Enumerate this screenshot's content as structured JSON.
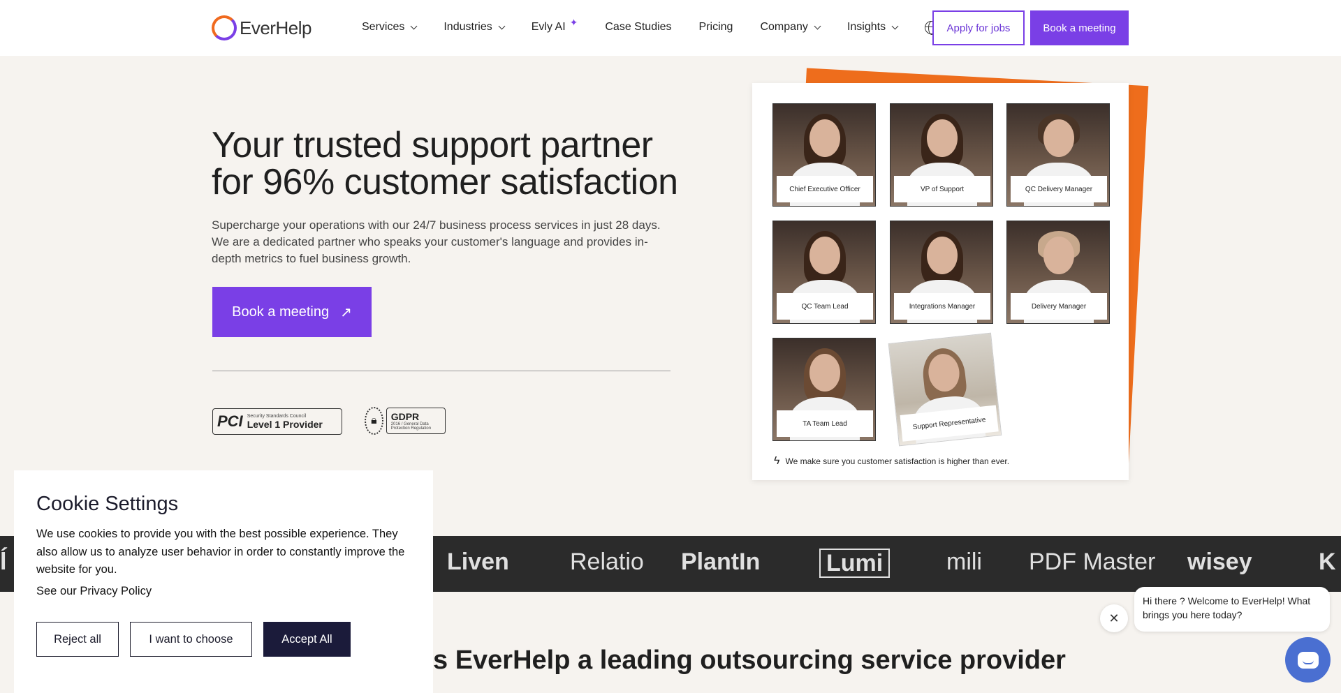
{
  "nav": {
    "logo_text": "EverHelp",
    "items": [
      {
        "label": "Services",
        "dropdown": true
      },
      {
        "label": "Industries",
        "dropdown": true
      },
      {
        "label": "Evly AI",
        "dropdown": false
      },
      {
        "label": "Case Studies",
        "dropdown": false
      },
      {
        "label": "Pricing",
        "dropdown": false
      },
      {
        "label": "Company",
        "dropdown": true
      },
      {
        "label": "Insights",
        "dropdown": true
      }
    ],
    "apply_label": "Apply for jobs",
    "book_label": "Book a meeting",
    "icons": {
      "globe": "globe-icon",
      "sparkle": "sparkle-icon"
    }
  },
  "hero": {
    "title_line1": "Your trusted support partner",
    "title_line2": "for 96% customer satisfaction",
    "description": "Supercharge your operations with our 24/7 business process services in just 28 days. We are a dedicated partner who speaks your customer's language and provides in-depth metrics to fuel business growth.",
    "cta_label": "Book a meeting",
    "badges": {
      "pci_small": "Security Standards Council",
      "pci_big": "Level 1 Provider",
      "pci_logo": "PCI",
      "gdpr_big": "GDPR",
      "gdpr_small": "2016 / General Data Protection Regulation"
    }
  },
  "team": {
    "members": [
      "Chief Executive Officer",
      "VP of Support",
      "QC Delivery Manager",
      "QC Team Lead",
      "Integrations Manager",
      "Delivery Manager",
      "TA Team Lead",
      "Support Representative"
    ],
    "footer": "We make sure you customer satisfaction is higher than ever."
  },
  "brands": [
    "Liven",
    "Relatio",
    "PlantIn",
    "Lumi",
    "mili",
    "PDF Master",
    "wisey"
  ],
  "section_heading": "s EverHelp a leading outsourcing service provider",
  "cookie": {
    "title": "Cookie Settings",
    "text": "We use cookies to provide you with the best possible experience. They also allow us to analyze user behavior in order to constantly improve the website for you.",
    "privacy_link": "See our Privacy Policy",
    "reject": "Reject all",
    "choose": "I want to choose",
    "accept": "Accept All"
  },
  "chat": {
    "message": "Hi there ? Welcome to EverHelp! What brings you here today?"
  },
  "colors": {
    "accent": "#7a3fe6",
    "orange": "#ee6d1c",
    "dark_band": "#2b2b2b",
    "chat": "#4a6fd1"
  }
}
